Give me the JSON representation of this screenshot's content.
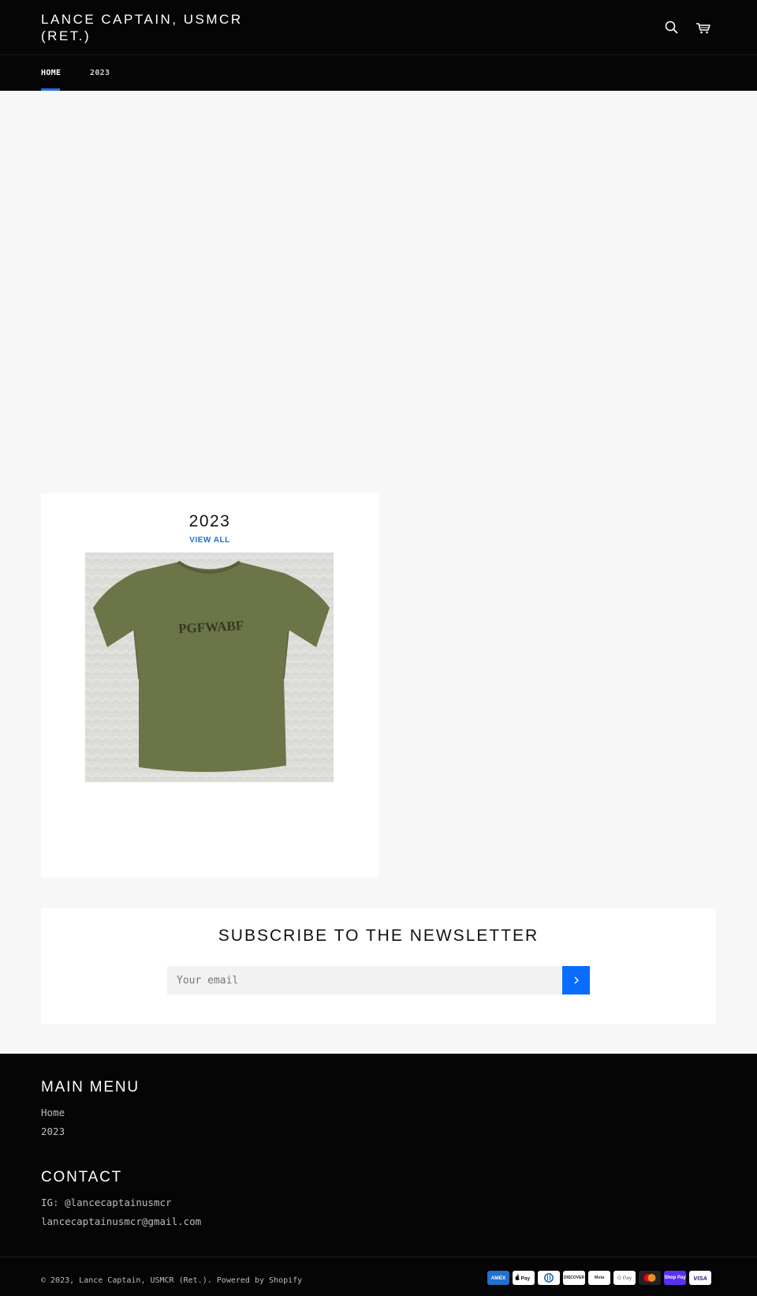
{
  "header": {
    "logo": "LANCE CAPTAIN, USMCR (RET.)",
    "icons": [
      "search-icon",
      "cart-icon"
    ]
  },
  "nav": {
    "items": [
      {
        "label": "HOME",
        "active": true
      },
      {
        "label": "2023",
        "active": false
      }
    ]
  },
  "collection": {
    "title": "2023",
    "view_all": "VIEW ALL",
    "image_alt": "Olive green t-shirt printed with PGFWABF",
    "shirt_print": "PGFWABF"
  },
  "newsletter": {
    "title": "SUBSCRIBE TO THE NEWSLETTER",
    "email_placeholder": "Your email",
    "submit_icon": "chevron-right-icon"
  },
  "footer": {
    "menu_title": "MAIN MENU",
    "menu_items": [
      "Home",
      "2023"
    ],
    "contact_title": "CONTACT",
    "contact_lines": [
      "IG: @lancecaptainusmcr",
      "lancecaptainusmcr@gmail.com"
    ],
    "copyright_prefix": "© 2023, ",
    "copyright_link": "Lance Captain, USMCR (Ret.)",
    "powered_by": ". Powered by Shopify",
    "payment_methods": [
      "AMEX",
      "Apple Pay",
      "Diners Club",
      "DISCOVER",
      "Meta",
      "G Pay",
      "Mastercard",
      "Shop Pay",
      "VISA"
    ]
  },
  "colors": {
    "header_bg": "#050505",
    "page_bg": "#f7f7f7",
    "accent_blue": "#0a6cff",
    "link_blue": "#1a6fd0",
    "shirt_olive": "#6b7547"
  }
}
